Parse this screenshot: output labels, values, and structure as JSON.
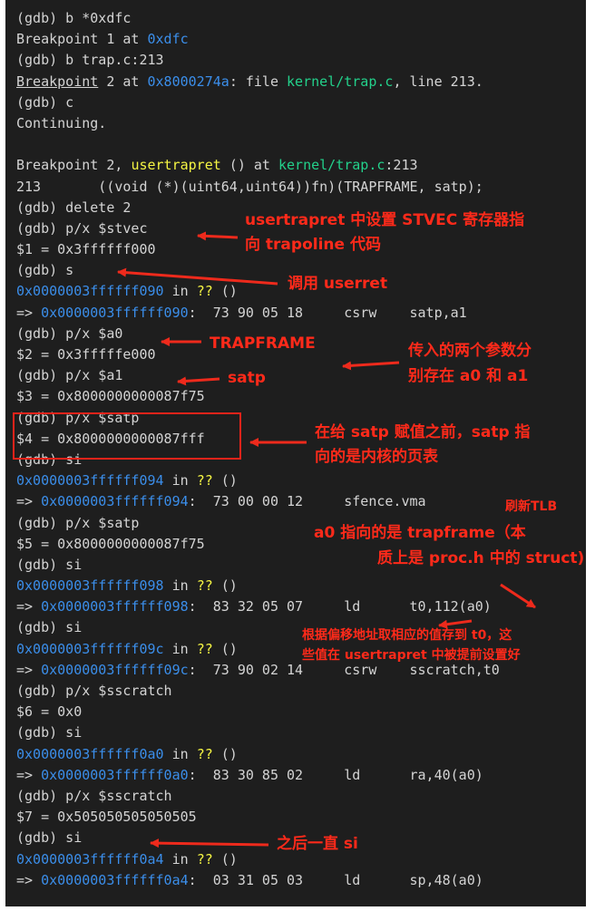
{
  "terminal": {
    "lines": [
      [
        "(gdb) b *0xdfc"
      ],
      [
        "Breakpoint 1 at ",
        "0xdfc"
      ],
      [
        "(gdb) b trap.c:213"
      ],
      [
        "Breakpoint",
        " 2 at ",
        "0x8000274a",
        ": file ",
        "kernel/trap.c",
        ", line 213."
      ],
      [
        "(gdb) c"
      ],
      [
        "Continuing."
      ],
      [
        ""
      ],
      [
        "Breakpoint 2, ",
        "usertrapret",
        " () at ",
        "kernel/trap.c",
        ":213"
      ],
      [
        "213       ((void (*)(uint64,uint64))fn)(TRAPFRAME, satp);"
      ],
      [
        "(gdb) delete 2"
      ],
      [
        "(gdb) p/x $stvec"
      ],
      [
        "$1 = 0x3ffffff000"
      ],
      [
        "(gdb) s"
      ],
      [
        "0x0000003ffffff090",
        " in ",
        "??",
        " ()"
      ],
      [
        "=> ",
        "0x0000003ffffff090",
        ":  73 90 05 18     csrw    satp,a1"
      ],
      [
        "(gdb) p/x $a0"
      ],
      [
        "$2 = 0x3fffffe000"
      ],
      [
        "(gdb) p/x $a1"
      ],
      [
        "$3 = 0x8000000000087f75"
      ],
      [
        "(gdb) p/x $satp"
      ],
      [
        "$4 = 0x8000000000087fff"
      ],
      [
        "(gdb) si"
      ],
      [
        "0x0000003ffffff094",
        " in ",
        "??",
        " ()"
      ],
      [
        "=> ",
        "0x0000003ffffff094",
        ":  73 00 00 12     sfence.vma"
      ],
      [
        "(gdb) p/x $satp"
      ],
      [
        "$5 = 0x8000000000087f75"
      ],
      [
        "(gdb) si"
      ],
      [
        "0x0000003ffffff098",
        " in ",
        "??",
        " ()"
      ],
      [
        "=> ",
        "0x0000003ffffff098",
        ":  83 32 05 07     ld      t0,112(a0)"
      ],
      [
        "(gdb) si"
      ],
      [
        "0x0000003ffffff09c",
        " in ",
        "??",
        " ()"
      ],
      [
        "=> ",
        "0x0000003ffffff09c",
        ":  73 90 02 14     csrw    sscratch,t0"
      ],
      [
        "(gdb) p/x $sscratch"
      ],
      [
        "$6 = 0x0"
      ],
      [
        "(gdb) si"
      ],
      [
        "0x0000003ffffff0a0",
        " in ",
        "??",
        " ()"
      ],
      [
        "=> ",
        "0x0000003ffffff0a0",
        ":  83 30 85 02     ld      ra,40(a0)"
      ],
      [
        "(gdb) p/x $sscratch"
      ],
      [
        "$7 = 0x505050505050505"
      ],
      [
        "(gdb) si"
      ],
      [
        "0x0000003ffffff0a4",
        " in ",
        "??",
        " ()"
      ],
      [
        "=> ",
        "0x0000003ffffff0a4",
        ":  03 31 05 03     ld      sp,48(a0)"
      ]
    ]
  },
  "annotations": {
    "stvec_1": "usertrapret 中设置 STVEC 寄存器指",
    "stvec_2": "向 trapoline 代码",
    "userret": "调用 userret",
    "trapframe": "TRAPFRAME",
    "args_1": "传入的两个参数分",
    "args_2": "别存在 a0 和 a1",
    "satp": "satp",
    "satp_before_1": "在给 satp 赋值之前，satp 指",
    "satp_before_2": "向的是内核的页表",
    "flush_tlb": "刷新TLB",
    "a0_1": "a0 指向的是 trapframe（本",
    "a0_2": "质上是 proc.h 中的 struct)",
    "offset_1": "根据偏移地址取相应的值存到 t0，这",
    "offset_2": "些值在 usertrapret 中被提前设置好",
    "then_si": "之后一直 si"
  },
  "colors": {
    "background": "#1e1e1e",
    "text": "#d4d4d4",
    "address": "#3b8eea",
    "path": "#23d18b",
    "function": "#f5f543",
    "annotation": "#ff2a1a"
  }
}
